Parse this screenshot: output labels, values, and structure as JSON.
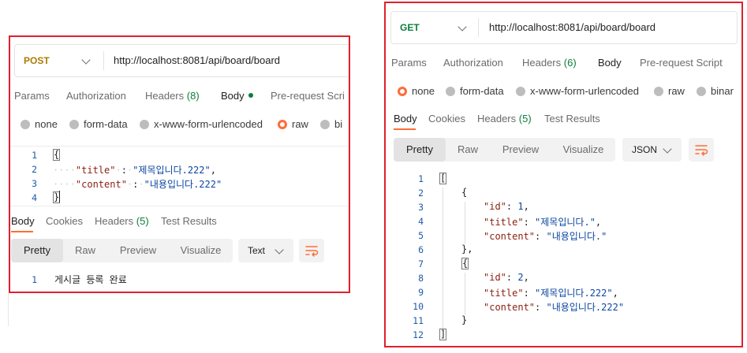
{
  "left": {
    "method": "POST",
    "url": "http://localhost:8081/api/board/board",
    "request_tabs": [
      "Params",
      "Authorization",
      "Headers",
      "Body",
      "Pre-request Scri"
    ],
    "headers_count": "(8)",
    "body_types": [
      "none",
      "form-data",
      "x-www-form-urlencoded",
      "raw",
      "bi"
    ],
    "selected_body_type": "raw",
    "request_body_lines": [
      "1",
      "2",
      "3",
      "4"
    ],
    "request_body": {
      "open": "{",
      "title_key": "\"title\"",
      "title_value": "\"제목입니다.222\"",
      "content_key": "\"content\"",
      "content_value": "\"내용입니다.222\"",
      "close": "}",
      "colon": ":",
      "comma": ","
    },
    "response_tabs": [
      "Body",
      "Cookies",
      "Headers",
      "Test Results"
    ],
    "response_headers_count": "(5)",
    "view_modes": [
      "Pretty",
      "Raw",
      "Preview",
      "Visualize"
    ],
    "selected_view": "Pretty",
    "format": "Text",
    "response_line_number": "1",
    "response_text": "게시글 등록 완료"
  },
  "right": {
    "method": "GET",
    "url": "http://localhost:8081/api/board/board",
    "request_tabs": [
      "Params",
      "Authorization",
      "Headers",
      "Body",
      "Pre-request Script"
    ],
    "headers_count": "(6)",
    "body_types": [
      "none",
      "form-data",
      "x-www-form-urlencoded",
      "raw",
      "binar"
    ],
    "selected_body_type": "none",
    "response_tabs": [
      "Body",
      "Cookies",
      "Headers",
      "Test Results"
    ],
    "response_headers_count": "(5)",
    "view_modes": [
      "Pretty",
      "Raw",
      "Preview",
      "Visualize"
    ],
    "selected_view": "Pretty",
    "format": "JSON",
    "line_numbers": [
      "1",
      "2",
      "3",
      "4",
      "5",
      "6",
      "7",
      "8",
      "9",
      "10",
      "11",
      "12"
    ],
    "json": {
      "open_array": "[",
      "close_array": "]",
      "open_obj": "{",
      "close_obj": "}",
      "close_obj_comma": "},",
      "id_key": "\"id\"",
      "title_key": "\"title\"",
      "content_key": "\"content\"",
      "id_1": "1",
      "title_1": "\"제목입니다.\"",
      "content_1": "\"내용입니다.\"",
      "id_2": "2",
      "title_2": "\"제목입니다.222\"",
      "content_2": "\"내용입니다.222\"",
      "colon": ":",
      "comma": ","
    }
  },
  "colors": {
    "highlight_border": "#e0202e",
    "accent": "#ff6c37",
    "post_method": "#ad7a03",
    "get_method": "#0b7d3e"
  }
}
